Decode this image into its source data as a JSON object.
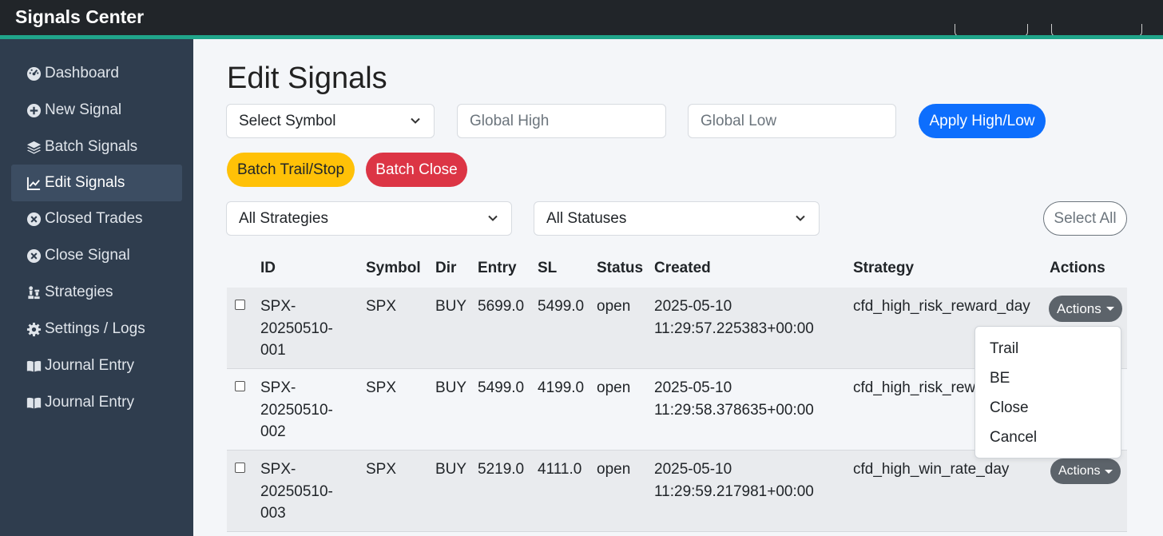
{
  "app": {
    "brand": "Signals Center"
  },
  "sidebar": {
    "items": [
      {
        "label": "Dashboard",
        "icon": "dashboard-icon"
      },
      {
        "label": "New Signal",
        "icon": "plus-circle-icon"
      },
      {
        "label": "Batch Signals",
        "icon": "layers-icon"
      },
      {
        "label": "Edit Signals",
        "icon": "chart-line-icon",
        "active": true
      },
      {
        "label": "Closed Trades",
        "icon": "x-circle-icon"
      },
      {
        "label": "Close Signal",
        "icon": "x-circle-icon"
      },
      {
        "label": "Strategies",
        "icon": "chess-icon"
      },
      {
        "label": "Settings / Logs",
        "icon": "gear-icon"
      },
      {
        "label": "Journal Entry",
        "icon": "book-icon"
      },
      {
        "label": "Journal Entry",
        "icon": "book-icon"
      }
    ]
  },
  "page": {
    "title": "Edit Signals"
  },
  "controls": {
    "symbol_select": "Select Symbol",
    "global_high_placeholder": "Global High",
    "global_low_placeholder": "Global Low",
    "apply_label": "Apply High/Low",
    "batch_trail_label": "Batch Trail/Stop",
    "batch_close_label": "Batch Close",
    "strategy_filter": "All Strategies",
    "status_filter": "All Statuses",
    "select_all_label": "Select All"
  },
  "table": {
    "headers": {
      "id": "ID",
      "symbol": "Symbol",
      "dir": "Dir",
      "entry": "Entry",
      "sl": "SL",
      "status": "Status",
      "created": "Created",
      "strategy": "Strategy",
      "actions": "Actions"
    },
    "rows": [
      {
        "id_1": "SPX-",
        "id_2": "20250510-",
        "id_3": "001",
        "symbol": "SPX",
        "dir": "BUY",
        "entry": "5699.0",
        "sl": "5499.0",
        "status": "open",
        "created_1": "2025-05-10",
        "created_2": "11:29:57.225383+00:00",
        "strategy": "cfd_high_risk_reward_day",
        "actions": "Actions"
      },
      {
        "id_1": "SPX-",
        "id_2": "20250510-",
        "id_3": "002",
        "symbol": "SPX",
        "dir": "BUY",
        "entry": "5499.0",
        "sl": "4199.0",
        "status": "open",
        "created_1": "2025-05-10",
        "created_2": "11:29:58.378635+00:00",
        "strategy": "cfd_high_risk_rewa",
        "actions": "Actions"
      },
      {
        "id_1": "SPX-",
        "id_2": "20250510-",
        "id_3": "003",
        "symbol": "SPX",
        "dir": "BUY",
        "entry": "5219.0",
        "sl": "4111.0",
        "status": "open",
        "created_1": "2025-05-10",
        "created_2": "11:29:59.217981+00:00",
        "strategy": "cfd_high_win_rate_day",
        "actions": "Actions"
      }
    ]
  },
  "actions_menu": {
    "items": [
      "Trail",
      "BE",
      "Close",
      "Cancel"
    ]
  }
}
